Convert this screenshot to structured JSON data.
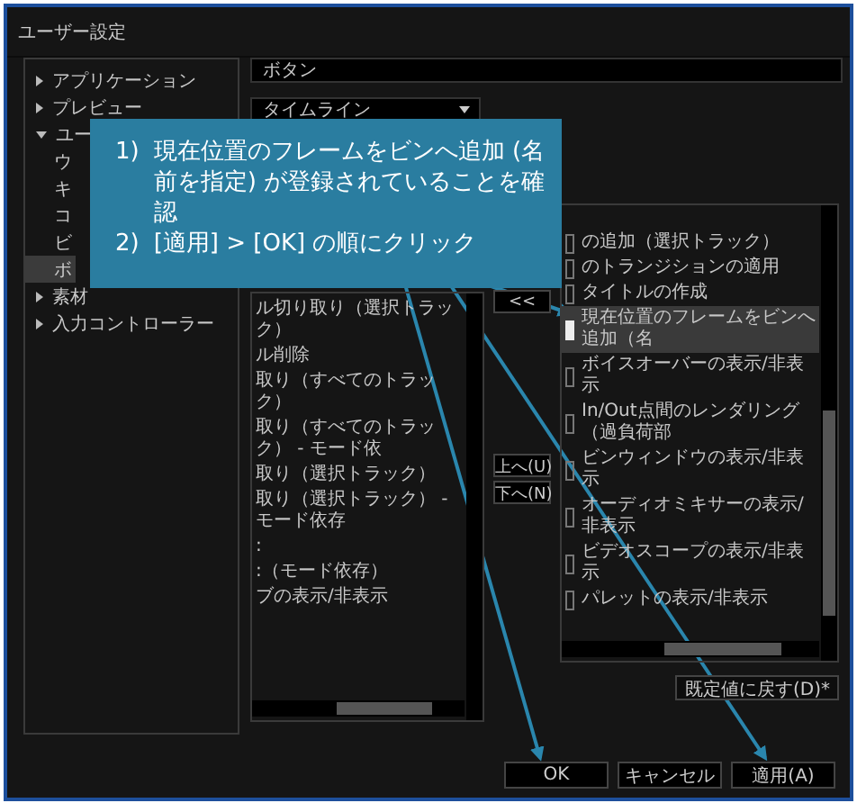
{
  "window": {
    "title": "ユーザー設定"
  },
  "tree": [
    {
      "label": "アプリケーション",
      "expanded": false,
      "selected": false
    },
    {
      "label": "プレビュー",
      "expanded": false,
      "selected": false
    },
    {
      "label": "ユー",
      "expanded": true,
      "selected": false,
      "children": [
        {
          "label": "ウ",
          "selected": false
        },
        {
          "label": "キ",
          "selected": false
        },
        {
          "label": "コ",
          "selected": false
        },
        {
          "label": "ビ",
          "selected": false
        },
        {
          "label": "ボ",
          "selected": true
        }
      ]
    },
    {
      "label": "素材",
      "expanded": false,
      "selected": false
    },
    {
      "label": "入力コントローラー",
      "expanded": false,
      "selected": false
    }
  ],
  "category_combo": {
    "value": "ボタン"
  },
  "section_combo": {
    "value": "タイムライン"
  },
  "available_list": [
    {
      "label": "ル切り取り（選択トラック）",
      "selected": false
    },
    {
      "label": "ル削除",
      "selected": false
    },
    {
      "label": "取り（すべてのトラック）",
      "selected": false
    },
    {
      "label": "取り（すべてのトラック） - モード依",
      "selected": false
    },
    {
      "label": "取り（選択トラック）",
      "selected": false
    },
    {
      "label": "取り（選択トラック） - モード依存",
      "selected": false
    },
    {
      "label": ":",
      "selected": false
    },
    {
      "label": ":（モード依存）",
      "selected": false
    },
    {
      "label": "ブの表示/非表示",
      "selected": false
    }
  ],
  "move_buttons": {
    "remove": "<<",
    "up": "上へ(U)",
    "down": "下へ(N)"
  },
  "assigned_list": [
    {
      "label": "の追加（選択トラック）",
      "selected": false
    },
    {
      "label": "のトランジションの適用",
      "selected": false
    },
    {
      "label": "タイトルの作成",
      "selected": false
    },
    {
      "label": "現在位置のフレームをビンへ追加（名",
      "selected": true
    },
    {
      "label": "ボイスオーバーの表示/非表示",
      "selected": false
    },
    {
      "label": "In/Out点間のレンダリング（過負荷部",
      "selected": false
    },
    {
      "label": "ビンウィンドウの表示/非表示",
      "selected": false
    },
    {
      "label": "オーディオミキサーの表示/非表示",
      "selected": false
    },
    {
      "label": "ビデオスコープの表示/非表示",
      "selected": false
    },
    {
      "label": "パレットの表示/非表示",
      "selected": false
    }
  ],
  "reset_button": "既定値に戻す(D)*",
  "buttons": [
    "OK",
    "キャンセル",
    "適用(A)"
  ],
  "callout": {
    "steps": [
      {
        "number": "1)",
        "text": "現在位置のフレームをビンへ追加 (名前を指定) が登録されていることを確認"
      },
      {
        "number": "2)",
        "text": "[適用] > [OK] の順にクリック"
      }
    ]
  }
}
